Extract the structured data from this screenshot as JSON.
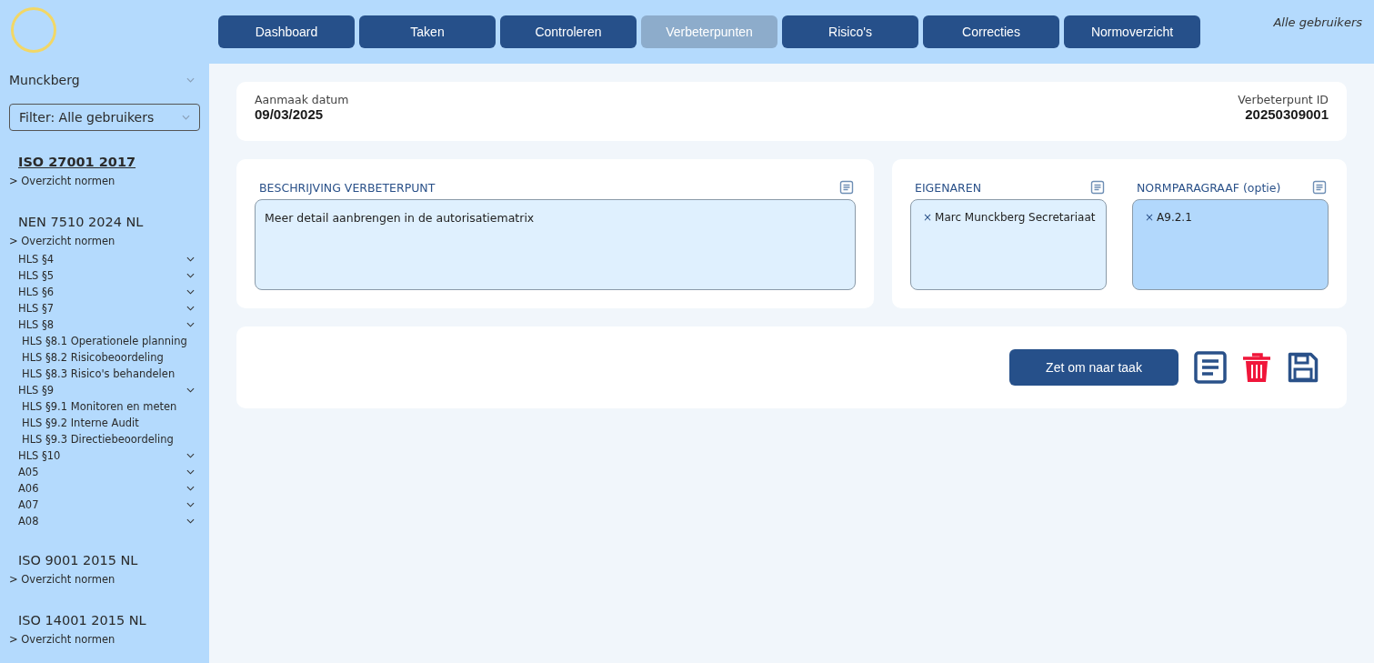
{
  "nav": {
    "tabs": [
      {
        "label": "Dashboard",
        "selected": false
      },
      {
        "label": "Taken",
        "selected": false
      },
      {
        "label": "Controleren",
        "selected": false
      },
      {
        "label": "Verbeterpunten",
        "selected": true
      },
      {
        "label": "Risico's",
        "selected": false
      },
      {
        "label": "Correcties",
        "selected": false
      },
      {
        "label": "Normoverzicht",
        "selected": false
      }
    ],
    "user_filter": "Alle gebruikers"
  },
  "sidebar": {
    "organization": "Munckberg",
    "filter": "Filter: Alle gebruikers",
    "norms": [
      {
        "title": "ISO 27001 2017",
        "selected": true,
        "link": "> Overzicht normen"
      },
      {
        "title": "NEN 7510 2024 NL",
        "selected": false,
        "link": "> Overzicht normen",
        "items": [
          {
            "label": "HLS §4"
          },
          {
            "label": "HLS §5"
          },
          {
            "label": "HLS §6"
          },
          {
            "label": "HLS §7"
          },
          {
            "label": "HLS §8",
            "children": [
              {
                "label": "HLS §8.1 Operationele planning"
              },
              {
                "label": "HLS §8.2 Risicobeoordeling"
              },
              {
                "label": "HLS §8.3 Risico's behandelen"
              }
            ]
          },
          {
            "label": "HLS §9",
            "children": [
              {
                "label": "HLS §9.1 Monitoren en meten"
              },
              {
                "label": "HLS §9.2 Interne Audit"
              },
              {
                "label": "HLS §9.3 Directiebeoordeling"
              }
            ]
          },
          {
            "label": "HLS §10"
          },
          {
            "label": "A05"
          },
          {
            "label": "A06"
          },
          {
            "label": "A07"
          },
          {
            "label": "A08"
          }
        ]
      },
      {
        "title": "ISO 9001 2015 NL",
        "selected": false,
        "link": "> Overzicht normen"
      },
      {
        "title": "ISO 14001 2015 NL",
        "selected": false,
        "link": "> Overzicht normen"
      }
    ]
  },
  "header": {
    "date_label": "Aanmaak datum",
    "date": "09/03/2025",
    "id_label": "Verbeterpunt ID",
    "id": "20250309001"
  },
  "description": {
    "label": "BESCHRIJVING VERBETERPUNT",
    "value": "Meer detail aanbrengen in de autorisatiematrix"
  },
  "owners": {
    "label": "EIGENAREN",
    "tags": [
      "Marc Munckberg Secretariaat"
    ],
    "remove_glyph": "×"
  },
  "norm_paragraph": {
    "label": "NORMPARAGRAAF (optie)",
    "tags": [
      "A9.2.1"
    ],
    "remove_glyph": "×"
  },
  "actions": {
    "convert_button": "Zet om naar taak"
  }
}
